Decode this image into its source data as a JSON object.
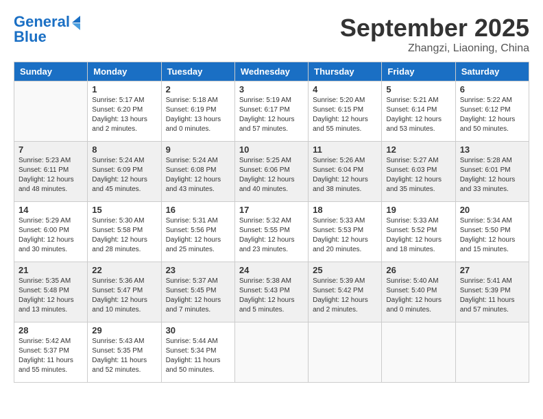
{
  "header": {
    "logo_line1": "General",
    "logo_line2": "Blue",
    "month_title": "September 2025",
    "subtitle": "Zhangzi, Liaoning, China"
  },
  "days_of_week": [
    "Sunday",
    "Monday",
    "Tuesday",
    "Wednesday",
    "Thursday",
    "Friday",
    "Saturday"
  ],
  "weeks": [
    [
      {
        "day": "",
        "info": ""
      },
      {
        "day": "1",
        "info": "Sunrise: 5:17 AM\nSunset: 6:20 PM\nDaylight: 13 hours\nand 2 minutes."
      },
      {
        "day": "2",
        "info": "Sunrise: 5:18 AM\nSunset: 6:19 PM\nDaylight: 13 hours\nand 0 minutes."
      },
      {
        "day": "3",
        "info": "Sunrise: 5:19 AM\nSunset: 6:17 PM\nDaylight: 12 hours\nand 57 minutes."
      },
      {
        "day": "4",
        "info": "Sunrise: 5:20 AM\nSunset: 6:15 PM\nDaylight: 12 hours\nand 55 minutes."
      },
      {
        "day": "5",
        "info": "Sunrise: 5:21 AM\nSunset: 6:14 PM\nDaylight: 12 hours\nand 53 minutes."
      },
      {
        "day": "6",
        "info": "Sunrise: 5:22 AM\nSunset: 6:12 PM\nDaylight: 12 hours\nand 50 minutes."
      }
    ],
    [
      {
        "day": "7",
        "info": "Sunrise: 5:23 AM\nSunset: 6:11 PM\nDaylight: 12 hours\nand 48 minutes."
      },
      {
        "day": "8",
        "info": "Sunrise: 5:24 AM\nSunset: 6:09 PM\nDaylight: 12 hours\nand 45 minutes."
      },
      {
        "day": "9",
        "info": "Sunrise: 5:24 AM\nSunset: 6:08 PM\nDaylight: 12 hours\nand 43 minutes."
      },
      {
        "day": "10",
        "info": "Sunrise: 5:25 AM\nSunset: 6:06 PM\nDaylight: 12 hours\nand 40 minutes."
      },
      {
        "day": "11",
        "info": "Sunrise: 5:26 AM\nSunset: 6:04 PM\nDaylight: 12 hours\nand 38 minutes."
      },
      {
        "day": "12",
        "info": "Sunrise: 5:27 AM\nSunset: 6:03 PM\nDaylight: 12 hours\nand 35 minutes."
      },
      {
        "day": "13",
        "info": "Sunrise: 5:28 AM\nSunset: 6:01 PM\nDaylight: 12 hours\nand 33 minutes."
      }
    ],
    [
      {
        "day": "14",
        "info": "Sunrise: 5:29 AM\nSunset: 6:00 PM\nDaylight: 12 hours\nand 30 minutes."
      },
      {
        "day": "15",
        "info": "Sunrise: 5:30 AM\nSunset: 5:58 PM\nDaylight: 12 hours\nand 28 minutes."
      },
      {
        "day": "16",
        "info": "Sunrise: 5:31 AM\nSunset: 5:56 PM\nDaylight: 12 hours\nand 25 minutes."
      },
      {
        "day": "17",
        "info": "Sunrise: 5:32 AM\nSunset: 5:55 PM\nDaylight: 12 hours\nand 23 minutes."
      },
      {
        "day": "18",
        "info": "Sunrise: 5:33 AM\nSunset: 5:53 PM\nDaylight: 12 hours\nand 20 minutes."
      },
      {
        "day": "19",
        "info": "Sunrise: 5:33 AM\nSunset: 5:52 PM\nDaylight: 12 hours\nand 18 minutes."
      },
      {
        "day": "20",
        "info": "Sunrise: 5:34 AM\nSunset: 5:50 PM\nDaylight: 12 hours\nand 15 minutes."
      }
    ],
    [
      {
        "day": "21",
        "info": "Sunrise: 5:35 AM\nSunset: 5:48 PM\nDaylight: 12 hours\nand 13 minutes."
      },
      {
        "day": "22",
        "info": "Sunrise: 5:36 AM\nSunset: 5:47 PM\nDaylight: 12 hours\nand 10 minutes."
      },
      {
        "day": "23",
        "info": "Sunrise: 5:37 AM\nSunset: 5:45 PM\nDaylight: 12 hours\nand 7 minutes."
      },
      {
        "day": "24",
        "info": "Sunrise: 5:38 AM\nSunset: 5:43 PM\nDaylight: 12 hours\nand 5 minutes."
      },
      {
        "day": "25",
        "info": "Sunrise: 5:39 AM\nSunset: 5:42 PM\nDaylight: 12 hours\nand 2 minutes."
      },
      {
        "day": "26",
        "info": "Sunrise: 5:40 AM\nSunset: 5:40 PM\nDaylight: 12 hours\nand 0 minutes."
      },
      {
        "day": "27",
        "info": "Sunrise: 5:41 AM\nSunset: 5:39 PM\nDaylight: 11 hours\nand 57 minutes."
      }
    ],
    [
      {
        "day": "28",
        "info": "Sunrise: 5:42 AM\nSunset: 5:37 PM\nDaylight: 11 hours\nand 55 minutes."
      },
      {
        "day": "29",
        "info": "Sunrise: 5:43 AM\nSunset: 5:35 PM\nDaylight: 11 hours\nand 52 minutes."
      },
      {
        "day": "30",
        "info": "Sunrise: 5:44 AM\nSunset: 5:34 PM\nDaylight: 11 hours\nand 50 minutes."
      },
      {
        "day": "",
        "info": ""
      },
      {
        "day": "",
        "info": ""
      },
      {
        "day": "",
        "info": ""
      },
      {
        "day": "",
        "info": ""
      }
    ]
  ]
}
